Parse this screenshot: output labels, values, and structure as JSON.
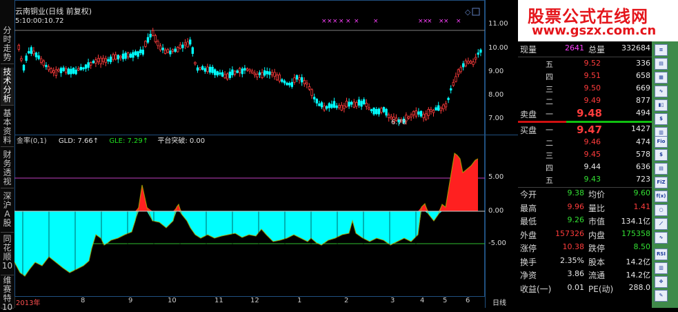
{
  "chart": {
    "title": "云南铜业(日线 前复权)",
    "ma_readout": "5:10:00:10.72",
    "low_marker": "6.78",
    "period_label": "日线",
    "price_axis": [
      "11.00",
      "10.00",
      "9.00",
      "8.00",
      "7.00"
    ],
    "indicator_axis": [
      "5.00",
      "0.00",
      "-5.00"
    ],
    "x_labels": [
      "2013年",
      "8",
      "9",
      "10",
      "11",
      "12",
      "1",
      "2",
      "3",
      "4",
      "5",
      "6"
    ],
    "indicator": {
      "name": "金率(0,1)",
      "gld": "GLD: 7.66↑",
      "gle": "GLE: 7.29↑",
      "breakout": "平台突破: 0.00"
    }
  },
  "left_tabs": [
    "分时走势",
    "技术分析",
    "基本资料",
    "财务透视",
    "深沪A股",
    "同花顺10",
    "维赛特10"
  ],
  "banner": {
    "line1": "股票公式在线网",
    "line2": "www.gszx.com.cn"
  },
  "quote": {
    "current_label": "现量",
    "current_value": "2641",
    "total_label": "总量",
    "total_value": "332684",
    "sell": [
      {
        "label": "五",
        "price": "9.52",
        "vol": "336"
      },
      {
        "label": "四",
        "price": "9.51",
        "vol": "658"
      },
      {
        "label": "三",
        "price": "9.50",
        "vol": "669"
      },
      {
        "label": "二",
        "price": "9.49",
        "vol": "877"
      },
      {
        "label": "一",
        "price": "9.48",
        "vol": "494"
      }
    ],
    "sell_title": "卖盘",
    "buy_title": "买盘",
    "buy": [
      {
        "label": "一",
        "price": "9.47",
        "vol": "1427"
      },
      {
        "label": "二",
        "price": "9.46",
        "vol": "474"
      },
      {
        "label": "三",
        "price": "9.45",
        "vol": "578"
      },
      {
        "label": "四",
        "price": "9.44",
        "vol": "636"
      },
      {
        "label": "五",
        "price": "9.43",
        "vol": "723"
      }
    ],
    "stats": [
      {
        "l1": "今开",
        "v1": "9.38",
        "l2": "均价",
        "v2": "9.60"
      },
      {
        "l1": "最高",
        "v1": "9.96",
        "l2": "量比",
        "v2": "1.41"
      },
      {
        "l1": "最低",
        "v1": "9.26",
        "l2": "市值",
        "v2": "134.1亿"
      },
      {
        "l1": "外盘",
        "v1": "157326",
        "l2": "内盘",
        "v2": "175358"
      },
      {
        "l1": "涨停",
        "v1": "10.38",
        "l2": "跌停",
        "v2": "8.50"
      },
      {
        "l1": "换手",
        "v1": "2.35%",
        "l2": "股本",
        "v2": "14.2亿"
      },
      {
        "l1": "净资",
        "v1": "3.86",
        "l2": "流通",
        "v2": "14.2亿"
      },
      {
        "l1": "收益(一)",
        "v1": "0.01",
        "l2": "PE(动)",
        "v2": "288.0"
      }
    ]
  },
  "right_icons": [
    "rsi-icon-label",
    "fio-icon-label",
    "fiz-icon-label"
  ],
  "icon_texts": {
    "rsi": "RSI",
    "fio": "Fio",
    "fiz": "FiZ",
    "fx": "f(x)"
  },
  "colors": {
    "up": "#ff3c3c",
    "down": "#00ffff",
    "bg": "#000000",
    "border": "#205080"
  }
}
